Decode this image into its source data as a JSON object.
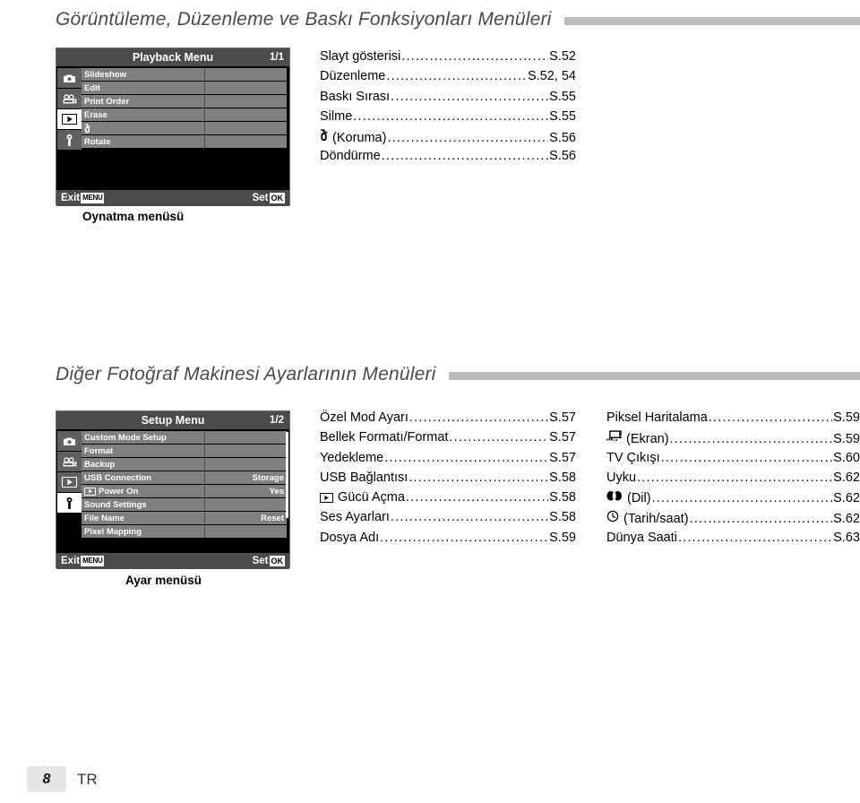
{
  "sections": [
    {
      "heading": "Görüntüleme, Düzenleme ve Baskı Fonksiyonları Menüleri",
      "caption": "Oynatma menüsü",
      "menu": {
        "title": "Playback Menu",
        "page_indicator": "1/1",
        "tabs": [
          {
            "name": "camera-tab",
            "icon": "camera-icon",
            "active": false
          },
          {
            "name": "movie-tab",
            "icon": "movie-camera-icon",
            "active": false
          },
          {
            "name": "playback-tab",
            "icon": "playback-icon",
            "active": true
          },
          {
            "name": "setup-tab",
            "icon": "wrench-icon",
            "active": false
          }
        ],
        "rows": [
          {
            "label": "Slideshow",
            "value": ""
          },
          {
            "label": "Edit",
            "value": ""
          },
          {
            "label": "Print Order",
            "value": ""
          },
          {
            "label": "Erase",
            "value": ""
          },
          {
            "label": "",
            "icon": "protect-key-icon",
            "value": ""
          },
          {
            "label": "Rotate",
            "value": ""
          }
        ],
        "footer": {
          "exit_label": "Exit",
          "exit_key": "MENU",
          "set_label": "Set",
          "set_key": "OK"
        }
      },
      "index_columns": [
        {
          "entries": [
            {
              "name": "Slayt gösterisi",
              "page": "S.52"
            },
            {
              "name": "Düzenleme",
              "page": "S.52, 54"
            },
            {
              "name": "Baskı Sırası",
              "page": "S.55"
            },
            {
              "name": "Silme",
              "page": "S.55"
            },
            {
              "icon": "protect-key-icon",
              "name": "(Koruma)",
              "page": "S.56"
            },
            {
              "name": "Döndürme",
              "page": "S.56"
            }
          ]
        }
      ]
    },
    {
      "heading": "Diğer Fotoğraf Makinesi Ayarlarının Menüleri",
      "caption": "Ayar menüsü",
      "menu": {
        "title": "Setup Menu",
        "page_indicator": "1/2",
        "tabs": [
          {
            "name": "camera-tab",
            "icon": "camera-icon",
            "active": false
          },
          {
            "name": "movie-tab",
            "icon": "movie-camera-icon",
            "active": false
          },
          {
            "name": "playback-tab",
            "icon": "playback-icon",
            "active": false
          },
          {
            "name": "setup-tab",
            "icon": "wrench-icon",
            "active": true
          }
        ],
        "rows": [
          {
            "label": "Custom Mode Setup",
            "value": ""
          },
          {
            "label": "Format",
            "value": ""
          },
          {
            "label": "Backup",
            "value": ""
          },
          {
            "label": "USB Connection",
            "value": "Storage"
          },
          {
            "label": "Power On",
            "icon": "playback-icon",
            "value": "Yes"
          },
          {
            "label": "Sound Settings",
            "value": ""
          },
          {
            "label": "File Name",
            "value": "Reset"
          },
          {
            "label": "Pixel Mapping",
            "value": ""
          }
        ],
        "footer": {
          "exit_label": "Exit",
          "exit_key": "MENU",
          "set_label": "Set",
          "set_key": "OK"
        }
      },
      "index_columns": [
        {
          "entries": [
            {
              "name": "Özel Mod Ayarı",
              "page": "S.57"
            },
            {
              "name": "Bellek Formatı/Format",
              "page": "S.57"
            },
            {
              "name": "Yedekleme",
              "page": "S.57"
            },
            {
              "name": "USB Bağlantısı",
              "page": "S.58"
            },
            {
              "icon": "playback-icon",
              "name": "Gücü Açma",
              "page": "S.58"
            },
            {
              "name": "Ses Ayarları",
              "page": "S.58"
            },
            {
              "name": "Dosya Adı",
              "page": "S.59"
            }
          ]
        },
        {
          "entries": [
            {
              "name": "Piksel Haritalama",
              "page": "S.59"
            },
            {
              "icon": "monitor-icon",
              "name": "(Ekran)",
              "page": "S.59"
            },
            {
              "name": "TV Çıkışı",
              "page": "S.60"
            },
            {
              "name": "Uyku",
              "page": "S.62"
            },
            {
              "icon": "language-icon",
              "name": "(Dil)",
              "page": "S.62"
            },
            {
              "icon": "clock-icon",
              "name": "(Tarih/saat)",
              "page": "S.62"
            },
            {
              "name": "Dünya Saati",
              "page": "S.63"
            }
          ]
        }
      ]
    }
  ],
  "footer": {
    "page_number": "8",
    "language_code": "TR"
  },
  "colors": {
    "rule": "#bcbcbc",
    "heading_text": "#4a4a4a",
    "lcd_title_bar": "#4b4b4b",
    "lcd_row": "#808080",
    "lcd_tab": "#606060",
    "page_badge": "#e6e6e6"
  }
}
